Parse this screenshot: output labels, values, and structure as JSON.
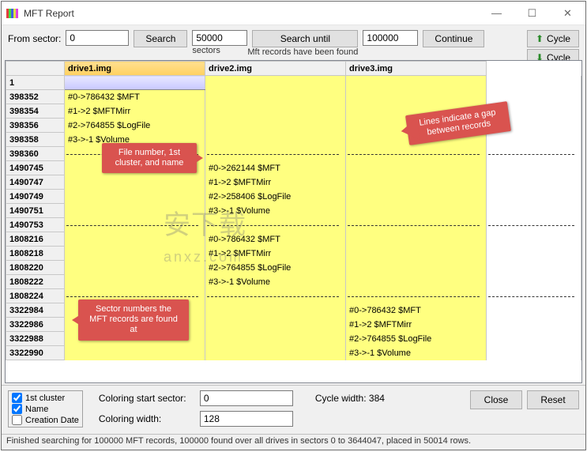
{
  "window": {
    "title": "MFT Report"
  },
  "toolbar": {
    "from_sector_label": "From sector:",
    "from_sector_value": "0",
    "search_label": "Search",
    "sectors_value": "50000",
    "sectors_sublabel": "sectors",
    "search_until_label": "Search until",
    "until_value": "100000",
    "until_sublabel": "Mft records have been found",
    "continue_label": "Continue",
    "cycle_label": "Cycle"
  },
  "columns": [
    "",
    "drive1.img",
    "drive2.img",
    "drive3.img"
  ],
  "rows": [
    {
      "sector": "1",
      "d1": "",
      "d2": "",
      "d3": "",
      "first": true,
      "highlight": "orange"
    },
    {
      "sector": "398352",
      "d1": "#0->786432 $MFT"
    },
    {
      "sector": "398354",
      "d1": "#1->2 $MFTMirr"
    },
    {
      "sector": "398356",
      "d1": "#2->764855 $LogFile"
    },
    {
      "sector": "398358",
      "d1": "#3->-1 $Volume"
    },
    {
      "sector": "398360",
      "sep": true
    },
    {
      "sector": "1490745",
      "d2": "#0->262144 $MFT"
    },
    {
      "sector": "1490747",
      "d2": "#1->2 $MFTMirr"
    },
    {
      "sector": "1490749",
      "d2": "#2->258406 $LogFile"
    },
    {
      "sector": "1490751",
      "d2": "#3->-1 $Volume"
    },
    {
      "sector": "1490753",
      "sep": true
    },
    {
      "sector": "1808216",
      "d2": "#0->786432 $MFT"
    },
    {
      "sector": "1808218",
      "d2": "#1->2 $MFTMirr"
    },
    {
      "sector": "1808220",
      "d2": "#2->764855 $LogFile"
    },
    {
      "sector": "1808222",
      "d2": "#3->-1 $Volume"
    },
    {
      "sector": "1808224",
      "sep": true
    },
    {
      "sector": "3322984",
      "d3": "#0->786432 $MFT"
    },
    {
      "sector": "3322986",
      "d3": "#1->2 $MFTMirr"
    },
    {
      "sector": "3322988",
      "d3": "#2->764855 $LogFile"
    },
    {
      "sector": "3322990",
      "d3": "#3->-1 $Volume"
    }
  ],
  "callouts": {
    "file_number": "File number, 1st cluster, and name",
    "lines_gap": "Lines indicate a gap between records",
    "sector_numbers": "Sector numbers the MFT records are found at"
  },
  "watermark": "安下载 anxz.com",
  "bottom": {
    "chk_1st_cluster": "1st cluster",
    "chk_name": "Name",
    "chk_creation": "Creation Date",
    "coloring_start_label": "Coloring start sector:",
    "coloring_start_value": "0",
    "coloring_width_label": "Coloring width:",
    "coloring_width_value": "128",
    "cycle_width_label": "Cycle width: 384",
    "close_label": "Close",
    "reset_label": "Reset"
  },
  "status": "Finished searching for 100000 MFT records, 100000 found over all drives in sectors 0 to 3644047, placed in 50014 rows."
}
